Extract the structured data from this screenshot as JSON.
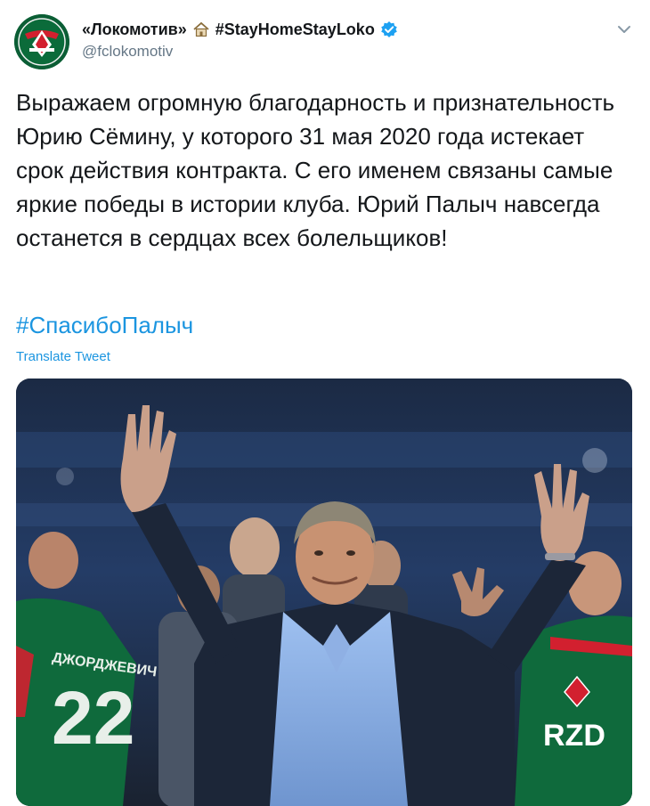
{
  "account": {
    "display_name": "«Локомотив»",
    "tag": "#StayHomeStayLoko",
    "handle": "@fclokomotiv",
    "avatar_icon": "lokomotiv-crest-icon",
    "house_icon": "house-emoji-icon",
    "verified_icon": "verified-badge-icon"
  },
  "tweet": {
    "text": "Выражаем огромную благодарность и признательность Юрию Сёмину, у которого 31 мая 2020 года истекает срок действия контракта. С его именем связаны самые яркие победы в истории клуба. Юрий Палыч навсегда останется в сердцах всех болельщиков!",
    "hashtag": "#СпасибоПалыч",
    "translate_label": "Translate Tweet"
  },
  "media": {
    "jersey_number": "22",
    "jersey_name": "ДЖОРДЖЕВИЧ",
    "sponsor": "RZD"
  },
  "colors": {
    "link": "#1b95e0",
    "text": "#14171a",
    "secondary": "#657786",
    "verified": "#1da1f2",
    "club_green": "#0b6b3a",
    "club_red": "#d2202f"
  }
}
